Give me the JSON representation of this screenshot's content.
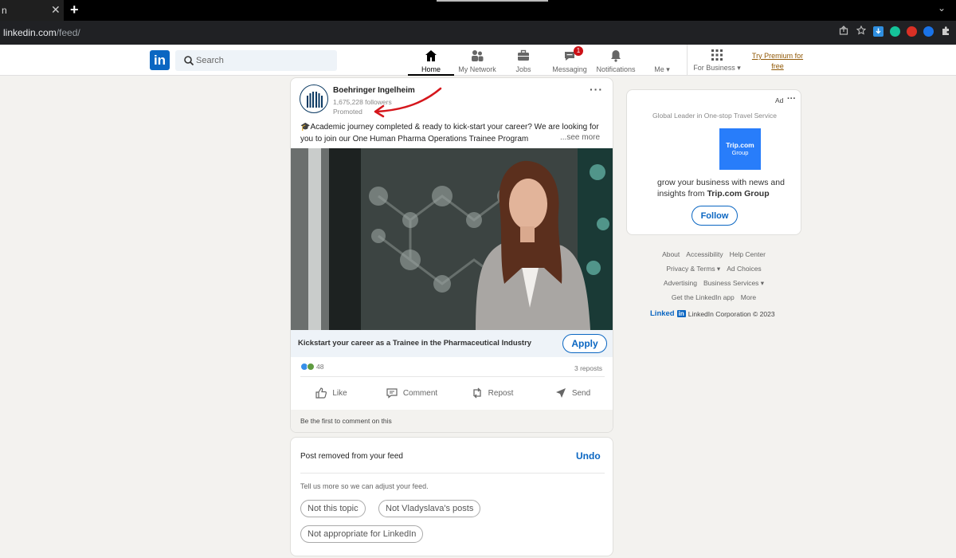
{
  "browser": {
    "tab_title": "n",
    "tab_close": "✕",
    "new_tab": "+",
    "url_host": "linkedin.com",
    "url_path": "/feed/",
    "menu": "⌄"
  },
  "header": {
    "logo": "in",
    "search_placeholder": "Search",
    "nav": [
      {
        "label": "Home",
        "icon": "home-icon",
        "active": true
      },
      {
        "label": "My Network",
        "icon": "people-icon"
      },
      {
        "label": "Jobs",
        "icon": "briefcase-icon"
      },
      {
        "label": "Messaging",
        "icon": "chat-icon",
        "badge": "1"
      },
      {
        "label": "Notifications",
        "icon": "bell-icon"
      },
      {
        "label": "Me ▾",
        "icon": "avatar-icon"
      }
    ],
    "for_business": "For Business ▾",
    "premium": "Try Premium for free"
  },
  "post": {
    "company": "Boehringer Ingelheim",
    "followers": "1,675,228 followers",
    "promoted": "Promoted",
    "menu": "···",
    "text": "🎓Academic journey completed & ready to kick-start your career? We are looking for you to join our One Human Pharma Operations Trainee Program",
    "see_more": "...see more",
    "cta_text": "Kickstart your career as a Trainee in the Pharmaceutical Industry",
    "apply": "Apply",
    "reaction_count": "48",
    "reposts": "3 reposts",
    "actions": {
      "like": "Like",
      "comment": "Comment",
      "repost": "Repost",
      "send": "Send"
    },
    "first_comment": "Be the first to comment on this"
  },
  "removed": {
    "title": "Post removed from your feed",
    "undo": "Undo",
    "desc": "Tell us more so we can adjust your feed.",
    "options": [
      "Not this topic",
      "Not Vladyslava's posts",
      "Not appropriate for LinkedIn"
    ]
  },
  "ad": {
    "label": "Ad",
    "menu": "···",
    "tagline": "Global Leader in One-stop Travel Service",
    "logo_line1": "Trip.com",
    "logo_line2": "Group",
    "body_prefix": "grow your business with news and insights from ",
    "body_brand": "Trip.com Group",
    "follow": "Follow"
  },
  "footer": {
    "links_row1": [
      "About",
      "Accessibility",
      "Help Center"
    ],
    "links_row2": [
      "Privacy & Terms ▾",
      "Ad Choices"
    ],
    "links_row3": [
      "Advertising",
      "Business Services ▾"
    ],
    "links_row4": [
      "Get the LinkedIn app",
      "More"
    ],
    "brand_word": "Linked",
    "brand_box": "in",
    "copyright": "LinkedIn Corporation © 2023"
  },
  "colors": {
    "brand": "#0a66c2",
    "badge": "#cc1016",
    "premium": "#915907",
    "trip": "#287dfa"
  }
}
